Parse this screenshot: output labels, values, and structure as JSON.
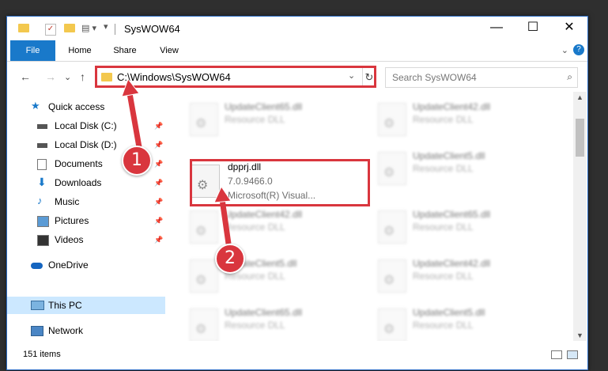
{
  "window": {
    "title": "SysWOW64",
    "minimize_glyph": "—",
    "maximize_glyph": "☐",
    "close_glyph": "✕"
  },
  "ribbon": {
    "tabs": [
      "File",
      "Home",
      "Share",
      "View"
    ],
    "help_glyph": "?",
    "expand_glyph": "⌄"
  },
  "navigation": {
    "back_glyph": "←",
    "forward_glyph": "→",
    "recent_glyph": "⌄",
    "up_glyph": "↑",
    "address_path": "C:\\Windows\\SysWOW64",
    "address_dropdown_glyph": "⌄",
    "refresh_glyph": "↻",
    "search_placeholder": "Search SysWOW64",
    "search_glyph": "⌕"
  },
  "sidebar": {
    "items": [
      {
        "label": "Quick access",
        "icon": "star-icon",
        "pinned": false
      },
      {
        "label": "Local Disk (C:)",
        "icon": "drive-icon",
        "pinned": true
      },
      {
        "label": "Local Disk (D:)",
        "icon": "drive-icon",
        "pinned": true
      },
      {
        "label": "Documents",
        "icon": "documents-icon",
        "pinned": true
      },
      {
        "label": "Downloads",
        "icon": "downloads-icon",
        "pinned": true
      },
      {
        "label": "Music",
        "icon": "music-icon",
        "pinned": true
      },
      {
        "label": "Pictures",
        "icon": "pictures-icon",
        "pinned": true
      },
      {
        "label": "Videos",
        "icon": "videos-icon",
        "pinned": true
      },
      {
        "label": "OneDrive",
        "icon": "onedrive-icon",
        "pinned": false
      },
      {
        "label": "This PC",
        "icon": "computer-icon",
        "pinned": false,
        "selected": true
      },
      {
        "label": "Network",
        "icon": "network-icon",
        "pinned": false
      }
    ],
    "pin_glyph": "📌"
  },
  "files": [
    {
      "name": "UpdateClient65.dll",
      "type": "Resource DLL",
      "blurred": true
    },
    {
      "name": "UpdateClient42.dll",
      "type": "Resource DLL",
      "blurred": true
    },
    {
      "name": "dpprj.dll",
      "type": "7.0.9466.0",
      "subtitle": "Microsoft(R) Visual...",
      "blurred": false,
      "highlighted": true
    },
    {
      "name": "UpdateClient5.dll",
      "type": "Resource DLL",
      "blurred": true
    },
    {
      "name": "UpdateClient42.dll",
      "type": "Resource DLL",
      "blurred": true
    },
    {
      "name": "UpdateClient65.dll",
      "type": "Resource DLL",
      "blurred": true
    },
    {
      "name": "UpdateClient5.dll",
      "type": "Resource DLL",
      "blurred": true
    },
    {
      "name": "UpdateClient42.dll",
      "type": "Resource DLL",
      "blurred": true
    },
    {
      "name": "UpdateClient65.dll",
      "type": "Resource DLL",
      "blurred": true
    },
    {
      "name": "UpdateClient5.dll",
      "type": "Resource DLL",
      "blurred": true
    }
  ],
  "status": {
    "item_count": "151 items"
  },
  "callouts": [
    {
      "number": "1",
      "target": "address bar"
    },
    {
      "number": "2",
      "target": "dpprj.dll"
    }
  ],
  "colors": {
    "accent": "#1979ca",
    "highlight": "#d9363e",
    "folder": "#f3c84e",
    "selected": "#cce8ff"
  }
}
